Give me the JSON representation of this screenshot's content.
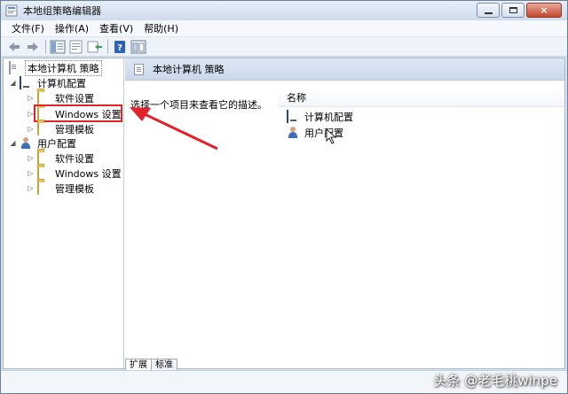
{
  "window": {
    "title": "本地组策略编辑器",
    "controls": {
      "minimize": "minimize",
      "maximize": "maximize",
      "close": "×"
    }
  },
  "menubar": {
    "items": [
      {
        "label": "文件(F)"
      },
      {
        "label": "操作(A)"
      },
      {
        "label": "查看(V)"
      },
      {
        "label": "帮助(H)"
      }
    ]
  },
  "toolbar": {
    "buttons": [
      "back-icon",
      "forward-icon",
      "show-hide-tree-icon",
      "properties-icon",
      "export-list-icon",
      "help-icon",
      "extended-view-icon"
    ]
  },
  "tree": {
    "root": "本地计算机 策略",
    "computer_config": "计算机配置",
    "computer_children": [
      "软件设置",
      "Windows 设置",
      "管理模板"
    ],
    "user_config": "用户配置",
    "user_children": [
      "软件设置",
      "Windows 设置",
      "管理模板"
    ]
  },
  "right_panel": {
    "header": "本地计算机 策略",
    "description": "选择一个项目来查看它的描述。",
    "column_name": "名称",
    "items": [
      "计算机配置",
      "用户配置"
    ]
  },
  "tabs": [
    "扩展",
    "标准"
  ],
  "watermark": "头条 @老毛桃winpe",
  "colors": {
    "highlight_box": "#e0222a",
    "header_bg": "#c9d8eb",
    "window_frame": "#dbe6f3"
  }
}
